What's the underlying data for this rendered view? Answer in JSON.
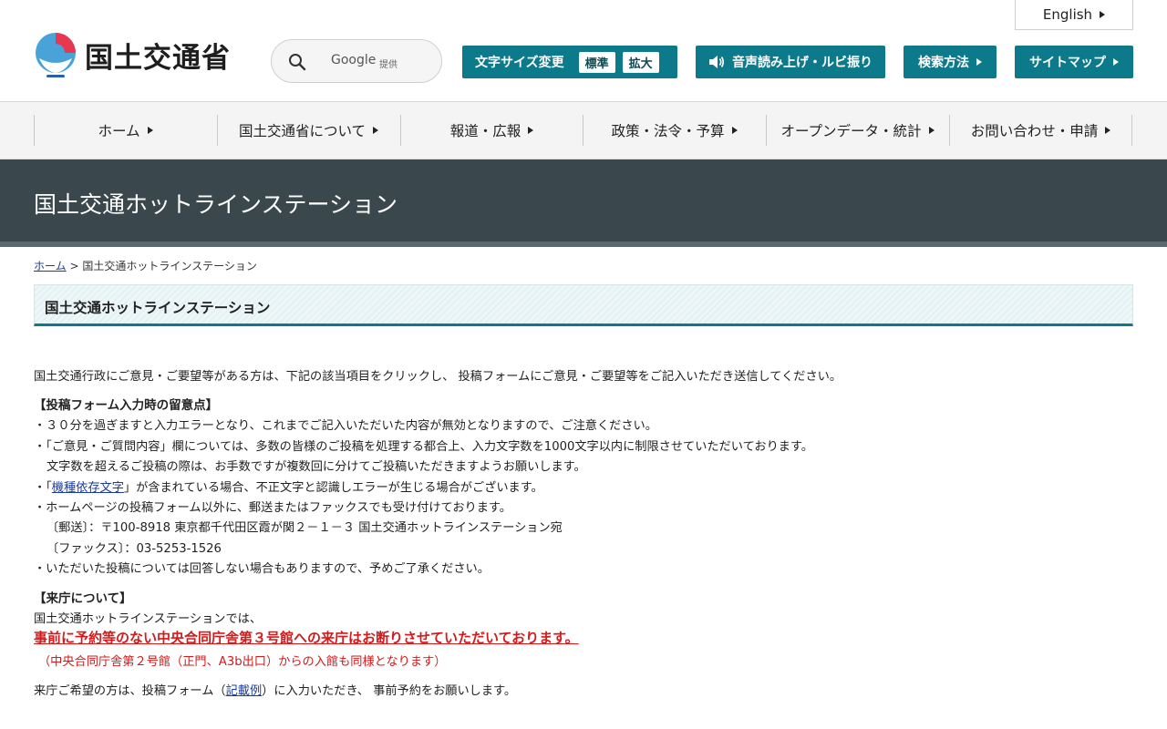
{
  "header": {
    "logo_text": "国土交通省",
    "search": {
      "provider": "Google",
      "provider_sub": "提供"
    },
    "english_label": "English",
    "font_size": {
      "label": "文字サイズ変更",
      "standard": "標準",
      "large": "拡大"
    },
    "voice_label": "音声読み上げ・ルビ振り",
    "search_method_label": "検索方法",
    "sitemap_label": "サイトマップ"
  },
  "nav": {
    "items": [
      {
        "label": "ホーム"
      },
      {
        "label": "国土交通省について"
      },
      {
        "label": "報道・広報"
      },
      {
        "label": "政策・法令・予算"
      },
      {
        "label": "オープンデータ・統計"
      },
      {
        "label": "お問い合わせ・申請"
      }
    ]
  },
  "banner": {
    "title": "国土交通ホットラインステーション"
  },
  "breadcrumb": {
    "home": "ホーム",
    "sep": ">",
    "current": "国土交通ホットラインステーション"
  },
  "section": {
    "title": "国土交通ホットラインステーション"
  },
  "content": {
    "intro": "国土交通行政にご意見・ご要望等がある方は、下記の該当項目をクリックし、 投稿フォームにご意見・ご要望等をご記入いただき送信してください。",
    "notes_title": "【投稿フォーム入力時の留意点】",
    "note1": "・３０分を過ぎますと入力エラーとなり、これまでご記入いただいた内容が無効となりますので、ご注意ください。",
    "note2": "・「ご意見・ご質問内容」欄については、多数の皆様のご投稿を処理する都合上、入力文字数を1000文字以内に制限させていただいております。",
    "note2b": "文字数を超えるご投稿の際は、お手数ですが複数回に分けてご投稿いただきますようお願いします。",
    "note3_pre": "・「",
    "note3_link": "機種依存文字",
    "note3_post": "」が含まれている場合、不正文字と認識しエラーが生じる場合がございます。",
    "note4": "・ホームページの投稿フォーム以外に、郵送またはファックスでも受け付けております。",
    "mail": "〔郵送〕：〒100-8918 東京都千代田区霞が関２－１－３ 国土交通ホットラインステーション宛",
    "fax": "〔ファックス〕：03-5253-1526",
    "note5": "・いただいた投稿については回答しない場合もありますので、予めご了承ください。",
    "visit_title": "【来庁について】",
    "visit1": "国土交通ホットラインステーションでは、",
    "visit_warn": "事前に予約等のない中央合同庁舎第３号館への来庁はお断りさせていただいております。",
    "visit_note": "（中央合同庁舎第２号館（正門、A3b出口）からの入館も同様となります）",
    "visit2_pre": "来庁ご希望の方は、投稿フォーム（",
    "visit2_link": "記載例",
    "visit2_post": "）に入力いただき、 事前予約をお願いします。"
  },
  "colors": {
    "accent": "#0d7a8c",
    "banner": "#3a474d",
    "warn": "#d41a1a"
  }
}
